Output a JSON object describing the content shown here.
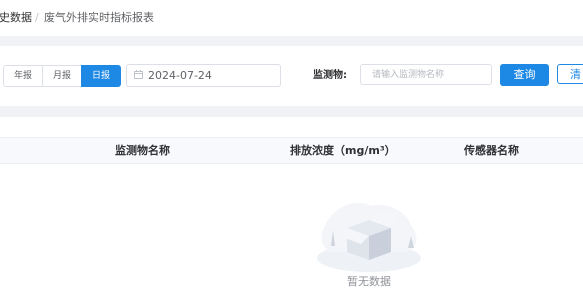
{
  "breadcrumb": {
    "parent": "史数据",
    "separator": "/",
    "current": "废气外排实时指标报表"
  },
  "filters": {
    "period_tabs": [
      {
        "label": "年报",
        "active": false
      },
      {
        "label": "月报",
        "active": false
      },
      {
        "label": "日报",
        "active": true
      }
    ],
    "date_value": "2024-07-24",
    "monitor_label": "监测物:",
    "monitor_placeholder": "请输入监测物名称",
    "query_label": "查询",
    "clear_label": "清"
  },
  "table": {
    "columns": [
      "监测物名称",
      "排放浓度（mg/m³）",
      "传感器名称"
    ],
    "empty_text": "暂无数据"
  },
  "colors": {
    "primary": "#1e88e5",
    "page_bg": "#f0f2f5"
  },
  "icons": [
    "calendar-icon",
    "empty-box-illustration"
  ]
}
